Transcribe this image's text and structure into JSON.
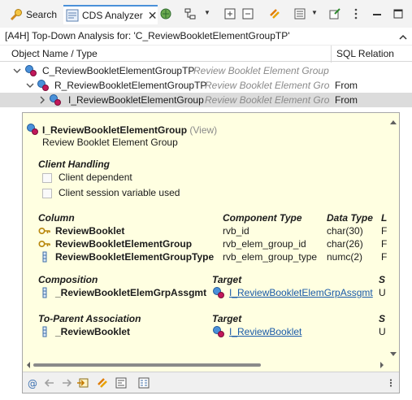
{
  "tabs": {
    "search_label": "Search",
    "cds_label": "CDS Analyzer",
    "close_glyph": "✕"
  },
  "header": {
    "analysis_title": "[A4H] Top-Down Analysis for: 'C_ReviewBookletElementGroupTP'"
  },
  "columns": {
    "object_name": "Object Name / Type",
    "sql_relation": "SQL Relation"
  },
  "tree": [
    {
      "name": "C_ReviewBookletElementGroupTP",
      "description": "Review Booklet Element Group",
      "relation": ""
    },
    {
      "name": "R_ReviewBookletElementGroupTP",
      "description": "Review Booklet Element Grou",
      "relation": "From"
    },
    {
      "name": "I_ReviewBookletElementGroup",
      "description": "Review Booklet Element Group",
      "relation": "From"
    }
  ],
  "tooltip": {
    "title": "I_ReviewBookletElementGroup",
    "kind": "(View)",
    "subtitle": "Review Booklet Element Group",
    "client_handling": {
      "heading": "Client Handling",
      "options": [
        "Client dependent",
        "Client session variable used"
      ]
    },
    "columns_table": {
      "headers": [
        "Column",
        "Component Type",
        "Data Type",
        "L"
      ],
      "rows": [
        {
          "name": "ReviewBooklet",
          "component": "rvb_id",
          "data_type": "char(30)",
          "extra": "F"
        },
        {
          "name": "ReviewBookletElementGroup",
          "component": "rvb_elem_group_id",
          "data_type": "char(26)",
          "extra": "F"
        },
        {
          "name": "ReviewBookletElementGroupType",
          "component": "rvb_elem_group_type",
          "data_type": "numc(2)",
          "extra": "F"
        }
      ]
    },
    "composition": {
      "headers": [
        "Composition",
        "Target",
        "S"
      ],
      "name": "_ReviewBookletElemGrpAssgmt",
      "target": "I_ReviewBookletElemGrpAssgmt",
      "extra": "U"
    },
    "to_parent": {
      "headers": [
        "To-Parent Association",
        "Target",
        "S"
      ],
      "name": "_ReviewBooklet",
      "target": "I_ReviewBooklet",
      "extra": "U"
    }
  },
  "icons": {
    "search_tab": "search-flashlight-icon",
    "cds_tab": "cds-analyzer-icon",
    "entity": "cds-entity-icon",
    "key": "key-icon",
    "field": "field-icon"
  },
  "colors": {
    "tooltip_bg": "#ffffe1",
    "link": "#1a5aa8",
    "selected_row": "#dcdcdc",
    "description_text": "#8a8a8a"
  }
}
